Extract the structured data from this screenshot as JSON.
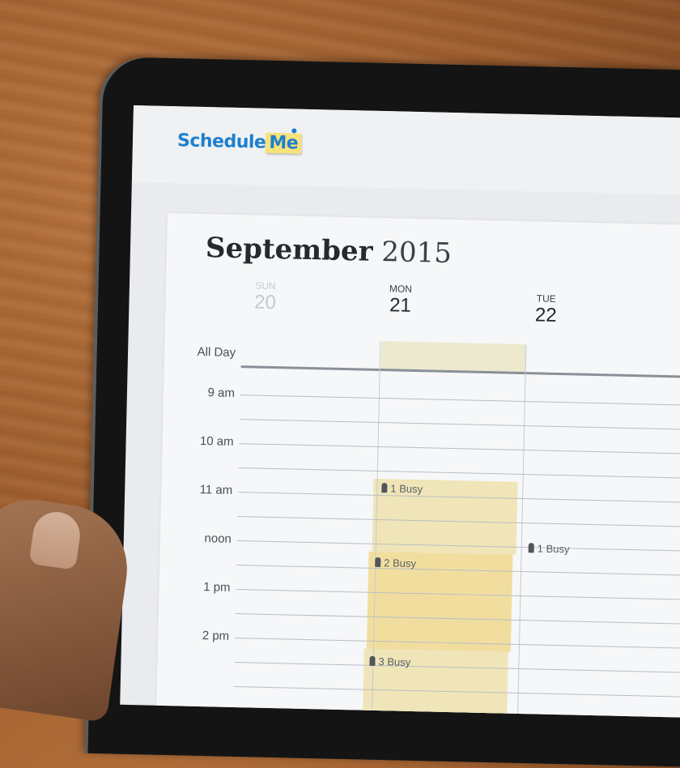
{
  "app": {
    "logo_schedule": "Schedule",
    "logo_me": "Me"
  },
  "calendar": {
    "month": "September",
    "year": "2015",
    "days": [
      {
        "name": "SUN",
        "date": "20",
        "faded": true
      },
      {
        "name": "MON",
        "date": "21",
        "faded": false
      },
      {
        "name": "TUE",
        "date": "22",
        "faded": false
      }
    ],
    "all_day_label": "All Day",
    "times": [
      "9 am",
      "10 am",
      "11 am",
      "noon",
      "1 pm",
      "2 pm"
    ],
    "busy": [
      {
        "day": "MON",
        "label": "1 Busy"
      },
      {
        "day": "MON",
        "label": "2 Busy"
      },
      {
        "day": "MON",
        "label": "3 Busy"
      },
      {
        "day": "TUE",
        "label": "1 Busy"
      }
    ]
  },
  "colors": {
    "brand": "#1e7fce",
    "logo_note": "#f8e27a",
    "busy_block": "#efe5b8"
  }
}
